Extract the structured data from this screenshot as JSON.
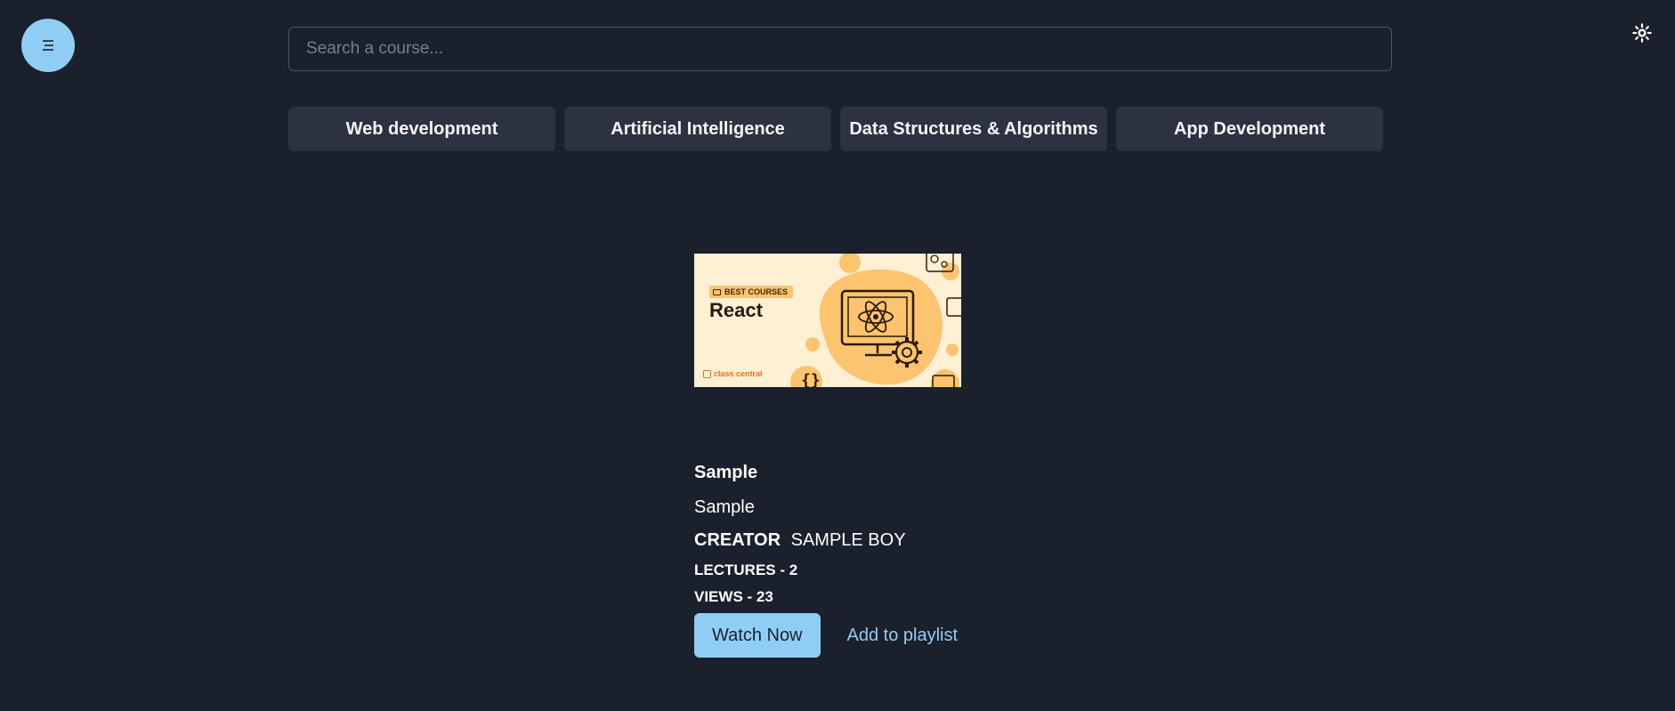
{
  "header": {
    "menu_icon": "menu-icon",
    "theme_icon": "sun-icon",
    "search_placeholder": "Search a course..."
  },
  "categories": [
    {
      "label": "Web development"
    },
    {
      "label": "Artificial Intelligence"
    },
    {
      "label": "Data Structures & Algorithms"
    },
    {
      "label": "App Development"
    }
  ],
  "course": {
    "thumbnail": {
      "badge": "BEST COURSES",
      "title": "React",
      "brand": "class central"
    },
    "title": "Sample",
    "description": "Sample",
    "creator_label": "CREATOR",
    "creator_name": "SAMPLE BOY",
    "lectures": "LECTURES - 2",
    "views": "VIEWS - 23",
    "watch_label": "Watch Now",
    "playlist_label": "Add to playlist"
  },
  "colors": {
    "background": "#1a202c",
    "accent": "#90cdf4",
    "category_bg": "#2d3240"
  }
}
